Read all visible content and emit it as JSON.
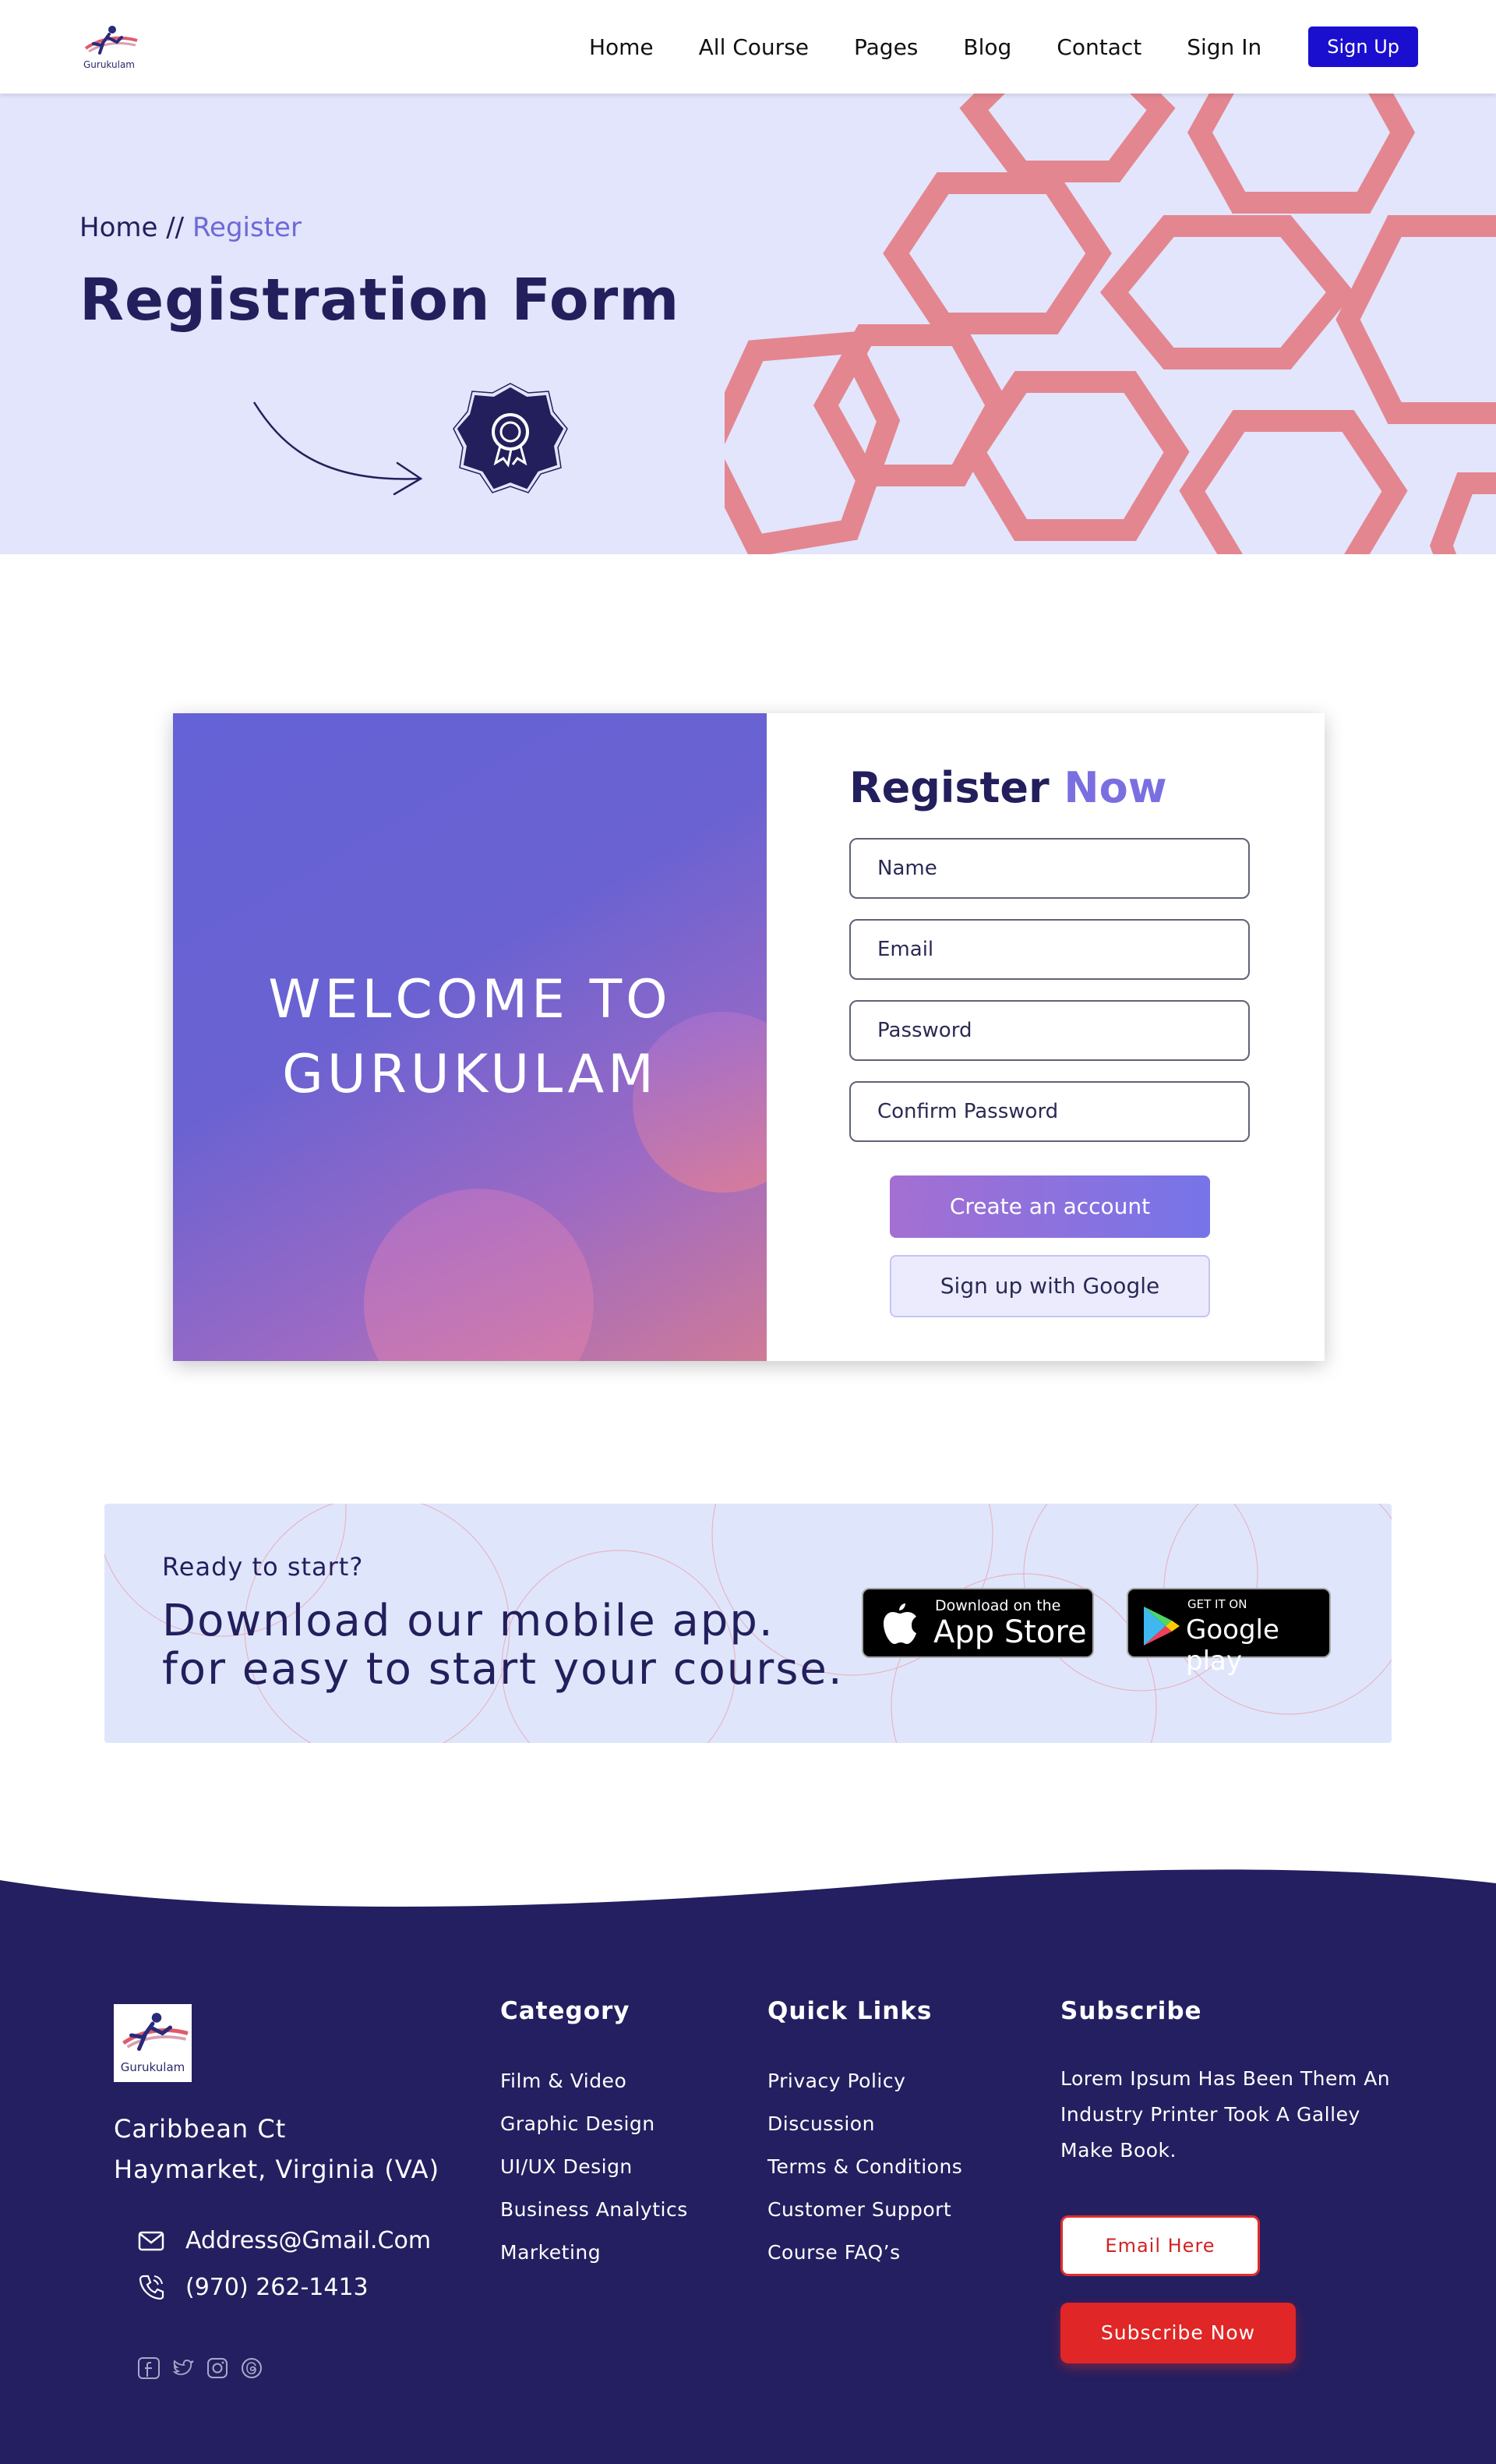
{
  "nav": {
    "logo_text": "Gurukulam",
    "links": [
      "Home",
      "All Course",
      "Pages",
      "Blog",
      "Contact",
      "Sign In"
    ],
    "signup_label": "Sign Up"
  },
  "hero": {
    "breadcrumb_home": "Home",
    "breadcrumb_separator": " // ",
    "breadcrumb_current": "Register",
    "title": "Registration Form"
  },
  "register": {
    "welcome_line1": "WELCOME TO",
    "welcome_line2": "GURUKULAM",
    "title_part1": "Register",
    "title_part2": "Now",
    "fields": {
      "name_placeholder": "Name",
      "email_placeholder": "Email",
      "password_placeholder": "Password",
      "confirm_placeholder": "Confirm Password"
    },
    "create_label": "Create an account",
    "google_label": "Sign up with Google"
  },
  "app_banner": {
    "ready": "Ready to start?",
    "line1": "Download our mobile app.",
    "line2": "for easy to start your course.",
    "appstore_small": "Download on the",
    "appstore_big": "App Store",
    "googleplay_small": "GET IT ON",
    "googleplay_big": "Google play"
  },
  "footer": {
    "logo_text": "Gurukulam",
    "address_line1": "Caribbean Ct",
    "address_line2": "Haymarket, Virginia (VA)",
    "email": "Address@Gmail.Com",
    "phone": "(970) 262-1413",
    "category_heading": "Category",
    "category_items": [
      "Film & Video",
      "Graphic Design",
      "UI/UX Design",
      "Business Analytics",
      "Marketing"
    ],
    "quicklinks_heading": "Quick Links",
    "quicklinks_items": [
      "Privacy Policy",
      "Discussion",
      "Terms & Conditions",
      "Customer Support",
      "Course FAQ’s"
    ],
    "subscribe_heading": "Subscribe",
    "subscribe_text": "Lorem Ipsum Has Been Them An Industry Printer Took A Galley Make Book.",
    "email_placeholder": "Email Here",
    "subscribe_button": "Subscribe Now"
  },
  "colors": {
    "primary_dark": "#231f5c",
    "accent_purple": "#6f68d8",
    "nav_button": "#1a0fcf",
    "hero_bg": "#e2e5fb",
    "hex_pink": "#e38690",
    "footer_bg": "#241f60",
    "subscribe_red": "#e02626"
  },
  "icons": [
    "logo-runner-icon",
    "arrow-icon",
    "award-badge-icon",
    "apple-icon",
    "google-play-icon",
    "mail-icon",
    "phone-icon",
    "facebook-icon",
    "twitter-icon",
    "instagram-icon",
    "threads-icon"
  ]
}
